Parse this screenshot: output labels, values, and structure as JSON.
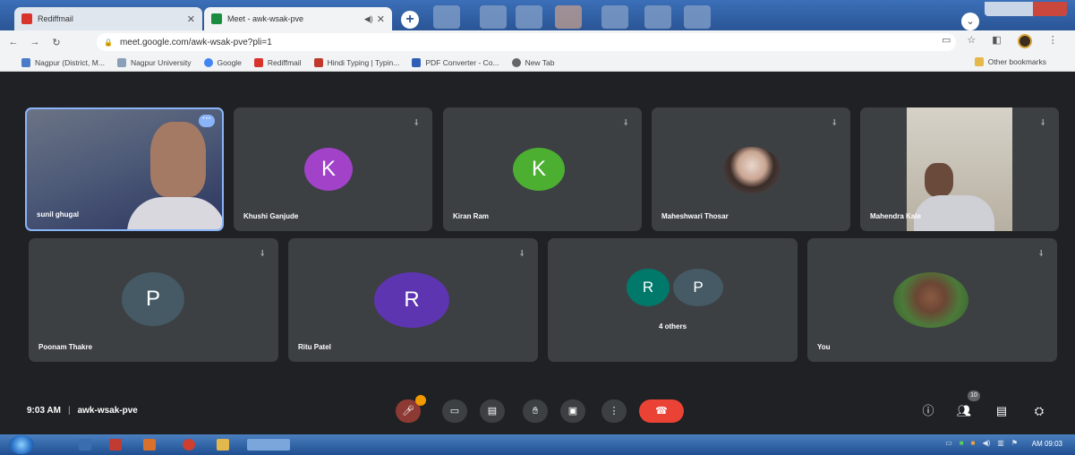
{
  "browser": {
    "tabs": [
      {
        "title": "Rediffmail",
        "active": false
      },
      {
        "title": "Meet - awk-wsak-pve",
        "active": true
      }
    ],
    "address": "meet.google.com/awk-wsak-pve?pli=1",
    "bookmarks": [
      "Nagpur (District, M...",
      "Nagpur University",
      "Google",
      "Rediffmail",
      "Hindi Typing | Typin...",
      "PDF Converter - Co...",
      "New Tab"
    ],
    "other_bookmarks": "Other bookmarks"
  },
  "meet": {
    "participants_row1": [
      {
        "name": "sunil ghugal",
        "type": "video"
      },
      {
        "name": "Khushi Ganjude",
        "type": "initial",
        "initial": "K",
        "color": "#a142c9"
      },
      {
        "name": "Kiran Ram",
        "type": "initial",
        "initial": "K",
        "color": "#4caf32"
      },
      {
        "name": "Maheshwari Thosar",
        "type": "photo"
      },
      {
        "name": "Mahendra Kale",
        "type": "video"
      }
    ],
    "participants_row2": [
      {
        "name": "Poonam Thakre",
        "type": "initial",
        "initial": "P",
        "color": "#455a64"
      },
      {
        "name": "Ritu Patel",
        "type": "initial",
        "initial": "R",
        "color": "#5e35b1"
      },
      {
        "name": "",
        "type": "group",
        "initials": [
          "R",
          "P"
        ],
        "colors": [
          "#00796b",
          "#455a64"
        ],
        "label": "4 others"
      },
      {
        "name": "You",
        "type": "photo"
      }
    ],
    "time": "9:03 AM",
    "meeting_code": "awk-wsak-pve",
    "people_count": "10"
  },
  "taskbar": {
    "clock": "AM 09:03"
  }
}
